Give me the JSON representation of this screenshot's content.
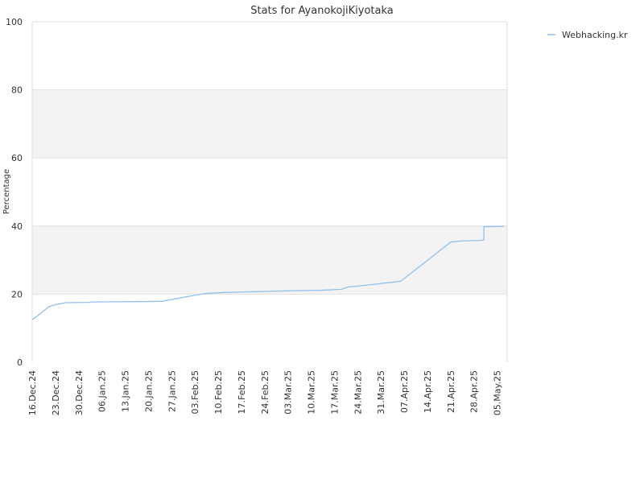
{
  "chart_data": {
    "type": "line",
    "title": "Stats for AyanokojiKiyotaka",
    "xlabel": "",
    "ylabel": "Percentage",
    "ylim": [
      0,
      100
    ],
    "yticks": [
      0,
      20,
      40,
      60,
      80,
      100
    ],
    "xlim": [
      "2024-12-16",
      "2025-05-08"
    ],
    "xtick_labels": [
      "16.Dec.24",
      "23.Dec.24",
      "30.Dec.24",
      "06.Jan.25",
      "13.Jan.25",
      "20.Jan.25",
      "27.Jan.25",
      "03.Feb.25",
      "10.Feb.25",
      "17.Feb.25",
      "24.Feb.25",
      "03.Mar.25",
      "10.Mar.25",
      "17.Mar.25",
      "24.Mar.25",
      "31.Mar.25",
      "07.Apr.25",
      "14.Apr.25",
      "21.Apr.25",
      "28.Apr.25",
      "05.May.25"
    ],
    "xtick_dates": [
      "2024-12-16",
      "2024-12-23",
      "2024-12-30",
      "2025-01-06",
      "2025-01-13",
      "2025-01-20",
      "2025-01-27",
      "2025-02-03",
      "2025-02-10",
      "2025-02-17",
      "2025-02-24",
      "2025-03-03",
      "2025-03-10",
      "2025-03-17",
      "2025-03-24",
      "2025-03-31",
      "2025-04-07",
      "2025-04-14",
      "2025-04-21",
      "2025-04-28",
      "2025-05-05"
    ],
    "grid": true,
    "alternating_bands": true,
    "legend_position": "top-right",
    "series": [
      {
        "name": "Webhacking.kr",
        "color": "#90c0ee",
        "points": [
          {
            "x": "2024-12-16",
            "y": 12.5
          },
          {
            "x": "2024-12-17",
            "y": 13.2
          },
          {
            "x": "2024-12-21",
            "y": 16.3
          },
          {
            "x": "2024-12-23",
            "y": 16.9
          },
          {
            "x": "2024-12-26",
            "y": 17.5
          },
          {
            "x": "2025-01-02",
            "y": 17.6
          },
          {
            "x": "2025-01-03",
            "y": 17.7
          },
          {
            "x": "2025-01-17",
            "y": 17.8
          },
          {
            "x": "2025-01-24",
            "y": 17.9
          },
          {
            "x": "2025-01-28",
            "y": 18.6
          },
          {
            "x": "2025-02-02",
            "y": 19.5
          },
          {
            "x": "2025-02-06",
            "y": 20.2
          },
          {
            "x": "2025-02-12",
            "y": 20.5
          },
          {
            "x": "2025-02-24",
            "y": 20.8
          },
          {
            "x": "2025-03-04",
            "y": 21.0
          },
          {
            "x": "2025-03-12",
            "y": 21.1
          },
          {
            "x": "2025-03-19",
            "y": 21.4
          },
          {
            "x": "2025-03-21",
            "y": 22.1
          },
          {
            "x": "2025-03-28",
            "y": 22.8
          },
          {
            "x": "2025-04-06",
            "y": 23.8
          },
          {
            "x": "2025-04-21",
            "y": 35.3
          },
          {
            "x": "2025-04-24",
            "y": 35.6
          },
          {
            "x": "2025-04-30",
            "y": 35.8
          },
          {
            "x": "2025-05-01",
            "y": 35.9
          },
          {
            "x": "2025-05-01",
            "y": 39.8
          },
          {
            "x": "2025-05-07",
            "y": 39.9
          }
        ]
      }
    ]
  }
}
